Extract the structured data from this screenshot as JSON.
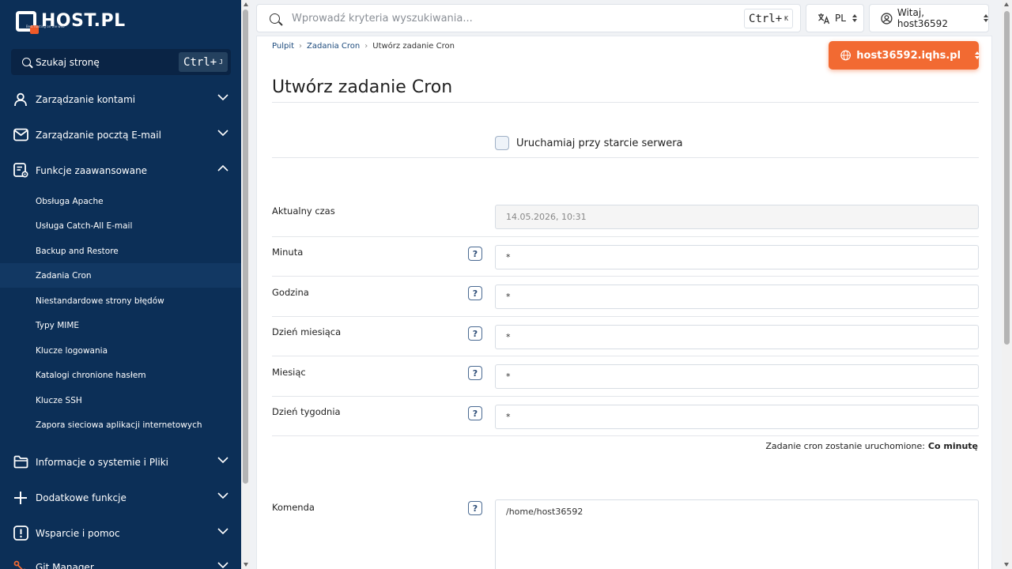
{
  "brand": {
    "name": "HOST.PL",
    "tagline": "Best hosting on the web"
  },
  "sidebar": {
    "search_label": "Szukaj stronę",
    "search_shortcut": "Ctrl+",
    "search_shortcut_key": "J",
    "sections": [
      {
        "label": "Zarządzanie kontami",
        "icon": "user-icon",
        "expanded": false
      },
      {
        "label": "Zarządzanie pocztą E-mail",
        "icon": "mail-icon",
        "expanded": false
      },
      {
        "label": "Funkcje zaawansowane",
        "icon": "advanced-settings-icon",
        "expanded": true
      },
      {
        "label": "Informacje o systemie i Pliki",
        "icon": "folder-icon",
        "expanded": false
      },
      {
        "label": "Dodatkowe funkcje",
        "icon": "plus-icon",
        "expanded": false
      },
      {
        "label": "Wsparcie i pomoc",
        "icon": "alert-icon",
        "expanded": false
      },
      {
        "label": "Git Manager",
        "icon": "git-icon",
        "expanded": false
      }
    ],
    "sub_items": [
      {
        "label": "Obsługa Apache",
        "active": false
      },
      {
        "label": "Usługa Catch-All E-mail",
        "active": false
      },
      {
        "label": "Backup and Restore",
        "active": false
      },
      {
        "label": "Zadania Cron",
        "active": true
      },
      {
        "label": "Niestandardowe strony błędów",
        "active": false
      },
      {
        "label": "Typy MIME",
        "active": false
      },
      {
        "label": "Klucze logowania",
        "active": false
      },
      {
        "label": "Katalogi chronione hasłem",
        "active": false
      },
      {
        "label": "Klucze SSH",
        "active": false
      },
      {
        "label": "Zapora sieciowa aplikacji internetowych",
        "active": false
      }
    ]
  },
  "topbar": {
    "search_placeholder": "Wprowadź kryteria wyszukiwania...",
    "search_shortcut": "Ctrl+",
    "search_shortcut_key": "K",
    "language": "PL",
    "user_greeting": "Witaj, host36592"
  },
  "breadcrumb": {
    "items": [
      "Pulpit",
      "Zadania Cron"
    ],
    "current": "Utwórz zadanie Cron"
  },
  "host_selector": "host36592.iqhs.pl",
  "page": {
    "title": "Utwórz zadanie Cron",
    "checkbox_label": "Uruchamiaj przy starcie serwera",
    "checkbox_checked": false,
    "current_time_label": "Aktualny czas",
    "current_time_value": "14.05.2026, 10:31",
    "fields": [
      {
        "label": "Minuta",
        "value": "*"
      },
      {
        "label": "Godzina",
        "value": "*"
      },
      {
        "label": "Dzień miesiąca",
        "value": "*"
      },
      {
        "label": "Miesiąc",
        "value": "*"
      },
      {
        "label": "Dzień tygodnia",
        "value": "*"
      }
    ],
    "run_info_label": "Zadanie cron zostanie uruchomione:",
    "run_info_value": "Co minutę",
    "command_label": "Komenda",
    "command_value": "/home/host36592",
    "help_glyph": "?"
  },
  "colors": {
    "sidebar_bg": "#0c2f57",
    "accent": "#f26a32",
    "link": "#1c4a7c"
  }
}
